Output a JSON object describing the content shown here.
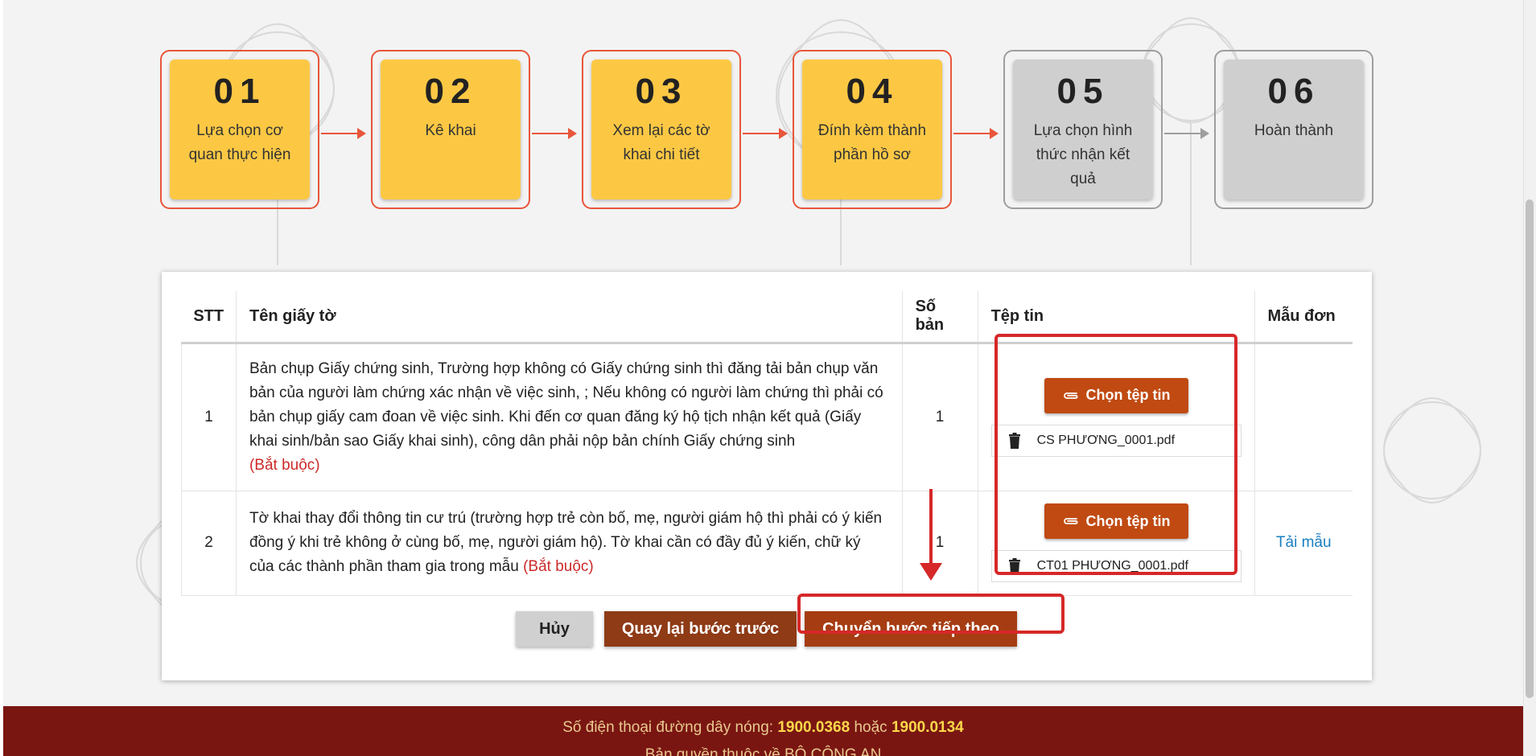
{
  "steps": [
    {
      "num": "01",
      "label": "Lựa chọn cơ quan thực hiện",
      "state": "active"
    },
    {
      "num": "02",
      "label": "Kê khai",
      "state": "active"
    },
    {
      "num": "03",
      "label": "Xem lại các tờ khai chi tiết",
      "state": "active"
    },
    {
      "num": "04",
      "label": "Đính kèm thành phần hồ sơ",
      "state": "active"
    },
    {
      "num": "05",
      "label": "Lựa chọn hình thức nhận kết quả",
      "state": "inactive"
    },
    {
      "num": "06",
      "label": "Hoàn thành",
      "state": "inactive"
    }
  ],
  "table": {
    "headers": [
      "STT",
      "Tên giấy tờ",
      "Số bản",
      "Tệp tin",
      "Mẫu đơn"
    ],
    "rows": [
      {
        "stt": "1",
        "name": "Bản chụp Giấy chứng sinh, Trường hợp không có Giấy chứng sinh thì đăng tải bản chụp văn bản của người làm chứng xác nhận về việc sinh, ; Nếu không có người làm chứng thì phải có bản chụp giấy cam đoan về việc sinh. Khi đến cơ quan đăng ký hộ tịch nhận kết quả (Giấy khai sinh/bản sao Giấy khai sinh), công dân phải nộp bản chính Giấy chứng sinh",
        "required": "(Bắt buộc)",
        "copies": "1",
        "choose_label": "Chọn tệp tin",
        "file": "CS PHƯƠNG_0001.pdf",
        "template": ""
      },
      {
        "stt": "2",
        "name": "Tờ khai thay đổi thông tin cư trú (trường hợp trẻ còn bố, mẹ, người giám hộ thì phải có ý kiến đồng ý khi trẻ không ở cùng bố, mẹ, người giám hộ). Tờ khai cần có đầy đủ ý kiến, chữ ký của các thành phần tham gia trong mẫu",
        "required": "(Bắt buộc)",
        "copies": "1",
        "choose_label": "Chọn tệp tin",
        "file": "CT01 PHƯƠNG_0001.pdf",
        "template": "Tải mẫu"
      }
    ]
  },
  "actions": {
    "cancel": "Hủy",
    "back": "Quay lại bước trước",
    "next": "Chuyển bước tiếp theo"
  },
  "footer": {
    "hotline_prefix": "Số điện thoại đường dây nóng:",
    "hotline_1": "1900.0368",
    "or": "hoặc",
    "hotline_2": "1900.0134",
    "copyright": "Bản quyền thuộc về BỘ CÔNG AN"
  },
  "colors": {
    "step_active": "#fcc844",
    "step_inactive": "#cfcfcf",
    "step_border_active": "#e8563b",
    "primary_button": "#c04a12",
    "footer_bg": "#7a1612",
    "annotation": "#d62828"
  },
  "icons": {
    "attach": "paperclip-icon",
    "delete": "trash-icon"
  }
}
